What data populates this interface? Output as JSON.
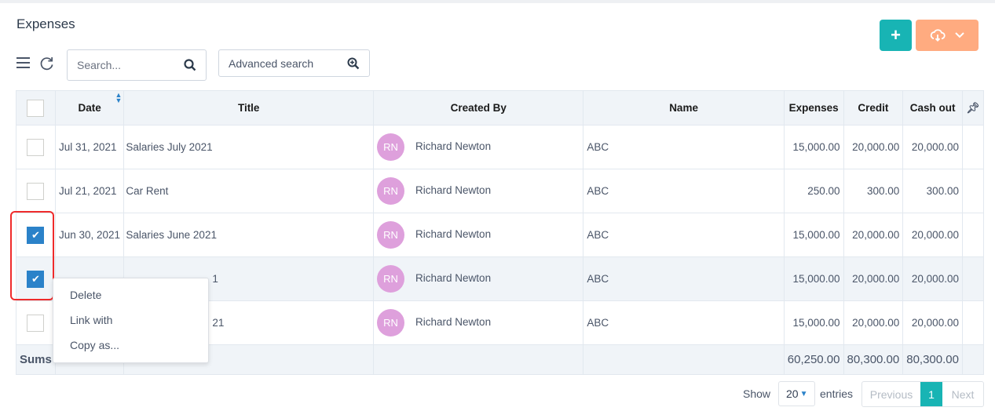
{
  "page": {
    "title": "Expenses"
  },
  "toolbar": {
    "add_icon": "plus-icon",
    "export_icon": "cloud-download-icon",
    "search_placeholder": "Search...",
    "advanced_search_label": "Advanced search"
  },
  "table": {
    "columns": [
      "Date",
      "Title",
      "Created By",
      "Name",
      "Expenses",
      "Credit",
      "Cash out"
    ],
    "rows": [
      {
        "checked": false,
        "date": "Jul 31, 2021",
        "title": "Salaries July 2021",
        "initials": "RN",
        "created_by": "Richard Newton",
        "name": "ABC",
        "expenses": "15,000.00",
        "credit": "20,000.00",
        "cash_out": "20,000.00"
      },
      {
        "checked": false,
        "date": "Jul 21, 2021",
        "title": "Car Rent",
        "initials": "RN",
        "created_by": "Richard Newton",
        "name": "ABC",
        "expenses": "250.00",
        "credit": "300.00",
        "cash_out": "300.00"
      },
      {
        "checked": true,
        "date": "Jun 30, 2021",
        "title": "Salaries June 2021",
        "initials": "RN",
        "created_by": "Richard Newton",
        "name": "ABC",
        "expenses": "15,000.00",
        "credit": "20,000.00",
        "cash_out": "20,000.00"
      },
      {
        "checked": true,
        "date": "",
        "title": "1",
        "initials": "RN",
        "created_by": "Richard Newton",
        "name": "ABC",
        "expenses": "15,000.00",
        "credit": "20,000.00",
        "cash_out": "20,000.00"
      },
      {
        "checked": false,
        "date": "",
        "title": "21",
        "initials": "RN",
        "created_by": "Richard Newton",
        "name": "ABC",
        "expenses": "15,000.00",
        "credit": "20,000.00",
        "cash_out": "20,000.00"
      }
    ],
    "sums": {
      "label": "Sums",
      "expenses": "60,250.00",
      "credit": "80,300.00",
      "cash_out": "80,300.00"
    }
  },
  "context_menu": {
    "items": [
      "Delete",
      "Link with",
      "Copy as..."
    ]
  },
  "footer": {
    "show_label": "Show",
    "page_size": "20",
    "entries_label": "entries",
    "previous": "Previous",
    "current_page": "1",
    "next": "Next"
  }
}
